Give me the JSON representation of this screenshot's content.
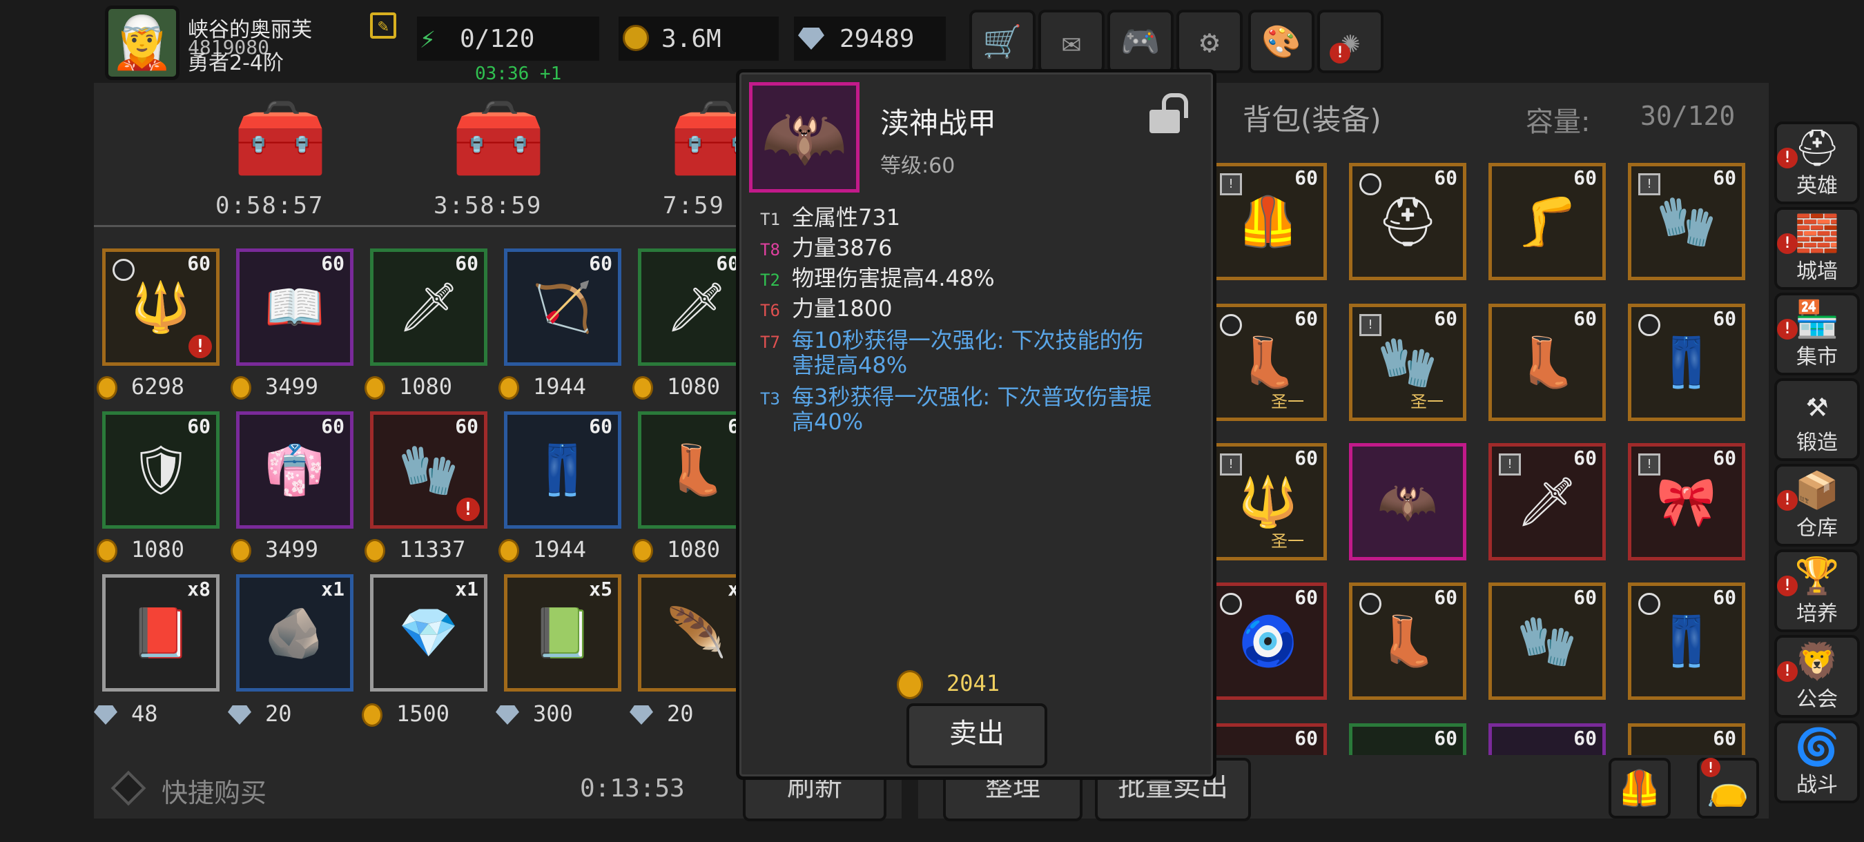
{
  "player": {
    "name": "峡谷的奥丽芙",
    "id": "4819080",
    "rank": "勇者2-4阶"
  },
  "currency": {
    "energy": "0/120",
    "energy_timer": "03:36 +1",
    "gold": "3.6M",
    "gems": "29489"
  },
  "top_icons": [
    "cart-icon",
    "mail-icon",
    "gamepad-icon",
    "gear-icon",
    "shutter-icon",
    "burst-icon"
  ],
  "shop": {
    "chest_timers": [
      "0:58:57",
      "3:58:59",
      "7:59"
    ],
    "row1": {
      "levels": [
        "60",
        "60",
        "60",
        "60",
        "60"
      ],
      "prices": [
        "6298",
        "3499",
        "1080",
        "1944",
        "1080"
      ]
    },
    "row2": {
      "levels": [
        "60",
        "60",
        "60",
        "60",
        "6"
      ],
      "prices": [
        "1080",
        "3499",
        "11337",
        "1944",
        "1080"
      ]
    },
    "row3": {
      "counts": [
        "x8",
        "x1",
        "x1",
        "x5",
        "x"
      ],
      "prices": [
        "48",
        "20",
        "1500",
        "300",
        "20"
      ]
    },
    "quick_buy": "快捷购买",
    "refresh_timer": "0:13:53",
    "refresh": "刷新"
  },
  "bag": {
    "title": "背包(装备)",
    "capacity_label": "容量:",
    "capacity": "30/120",
    "levels": [
      "60",
      "60",
      "60",
      "60",
      "60",
      "60",
      "60",
      "60",
      "60",
      "60",
      "60",
      "60",
      "60",
      "60",
      "60",
      "60",
      "60",
      "60",
      "60",
      "60"
    ],
    "tags": [
      "圣一",
      "圣一",
      "圣一"
    ],
    "sort": "整理",
    "bulk_sell": "批量卖出"
  },
  "tooltip": {
    "name": "渎神战甲",
    "level": "等级:60",
    "stats": [
      {
        "tier": "T1",
        "text": "全属性731",
        "color": "#e8e8e8"
      },
      {
        "tier": "T8",
        "text": "力量3876",
        "color": "#e8e8e8"
      },
      {
        "tier": "T2",
        "text": "物理伤害提高4.48%",
        "color": "#e8e8e8"
      },
      {
        "tier": "T6",
        "text": "力量1800",
        "color": "#e8e8e8"
      },
      {
        "tier": "T7",
        "text": "每10秒获得一次强化: 下次技能的伤",
        "text2": "害提高48%",
        "color": "#5aa6e8"
      },
      {
        "tier": "T3",
        "text": "每3秒获得一次强化: 下次普攻伤害提",
        "text2": "高40%",
        "color": "#5aa6e8"
      }
    ],
    "price": "2041",
    "sell": "卖出",
    "tier_colors": {
      "T1": "#cfcfcf",
      "T8": "#e040a0",
      "T2": "#30c050",
      "T6": "#e05050",
      "T7": "#e05050",
      "T3": "#5aa6e8"
    }
  },
  "side_menu": [
    "英雄",
    "城墙",
    "集市",
    "锻造",
    "仓库",
    "培养",
    "公会",
    "战斗"
  ]
}
